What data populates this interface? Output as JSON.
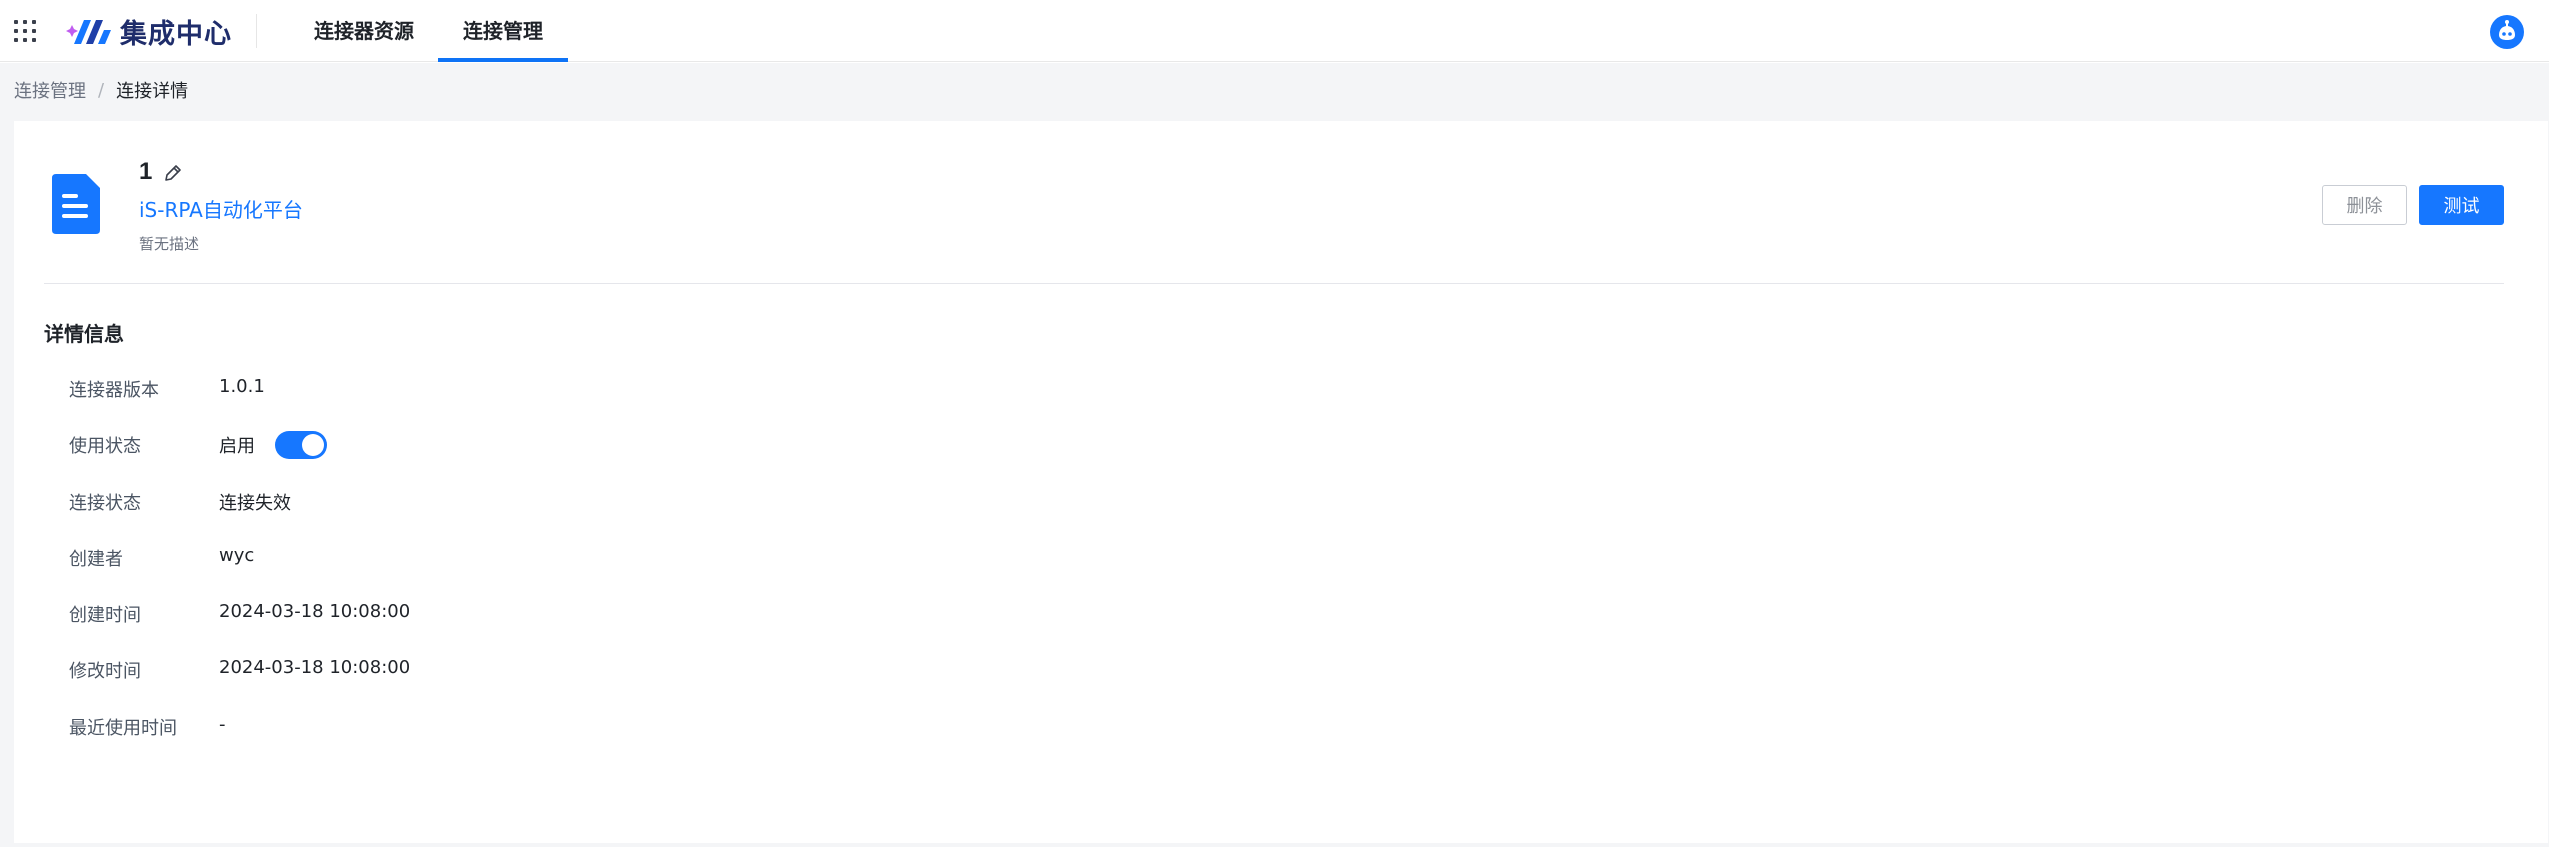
{
  "header": {
    "logo_text": "集成中心",
    "tabs": [
      {
        "label": "连接器资源",
        "active": false
      },
      {
        "label": "连接管理",
        "active": true
      }
    ],
    "accent_color": "#1677ff"
  },
  "breadcrumb": {
    "items": [
      "连接管理",
      "连接详情"
    ],
    "separator": "/"
  },
  "connection": {
    "name": "1",
    "platform": "iS-RPA自动化平台",
    "description": "暂无描述",
    "icon": "document-icon"
  },
  "actions": {
    "delete_label": "删除",
    "test_label": "测试"
  },
  "details": {
    "section_title": "详情信息",
    "rows": [
      {
        "label": "连接器版本",
        "value": "1.0.1"
      },
      {
        "label": "使用状态",
        "value": "启用",
        "toggle_on": true
      },
      {
        "label": "连接状态",
        "value": "连接失效"
      },
      {
        "label": "创建者",
        "value": "wyc"
      },
      {
        "label": "创建时间",
        "value": "2024-03-18 10:08:00"
      },
      {
        "label": "修改时间",
        "value": "2024-03-18 10:08:00"
      },
      {
        "label": "最近使用时间",
        "value": "-"
      }
    ]
  }
}
